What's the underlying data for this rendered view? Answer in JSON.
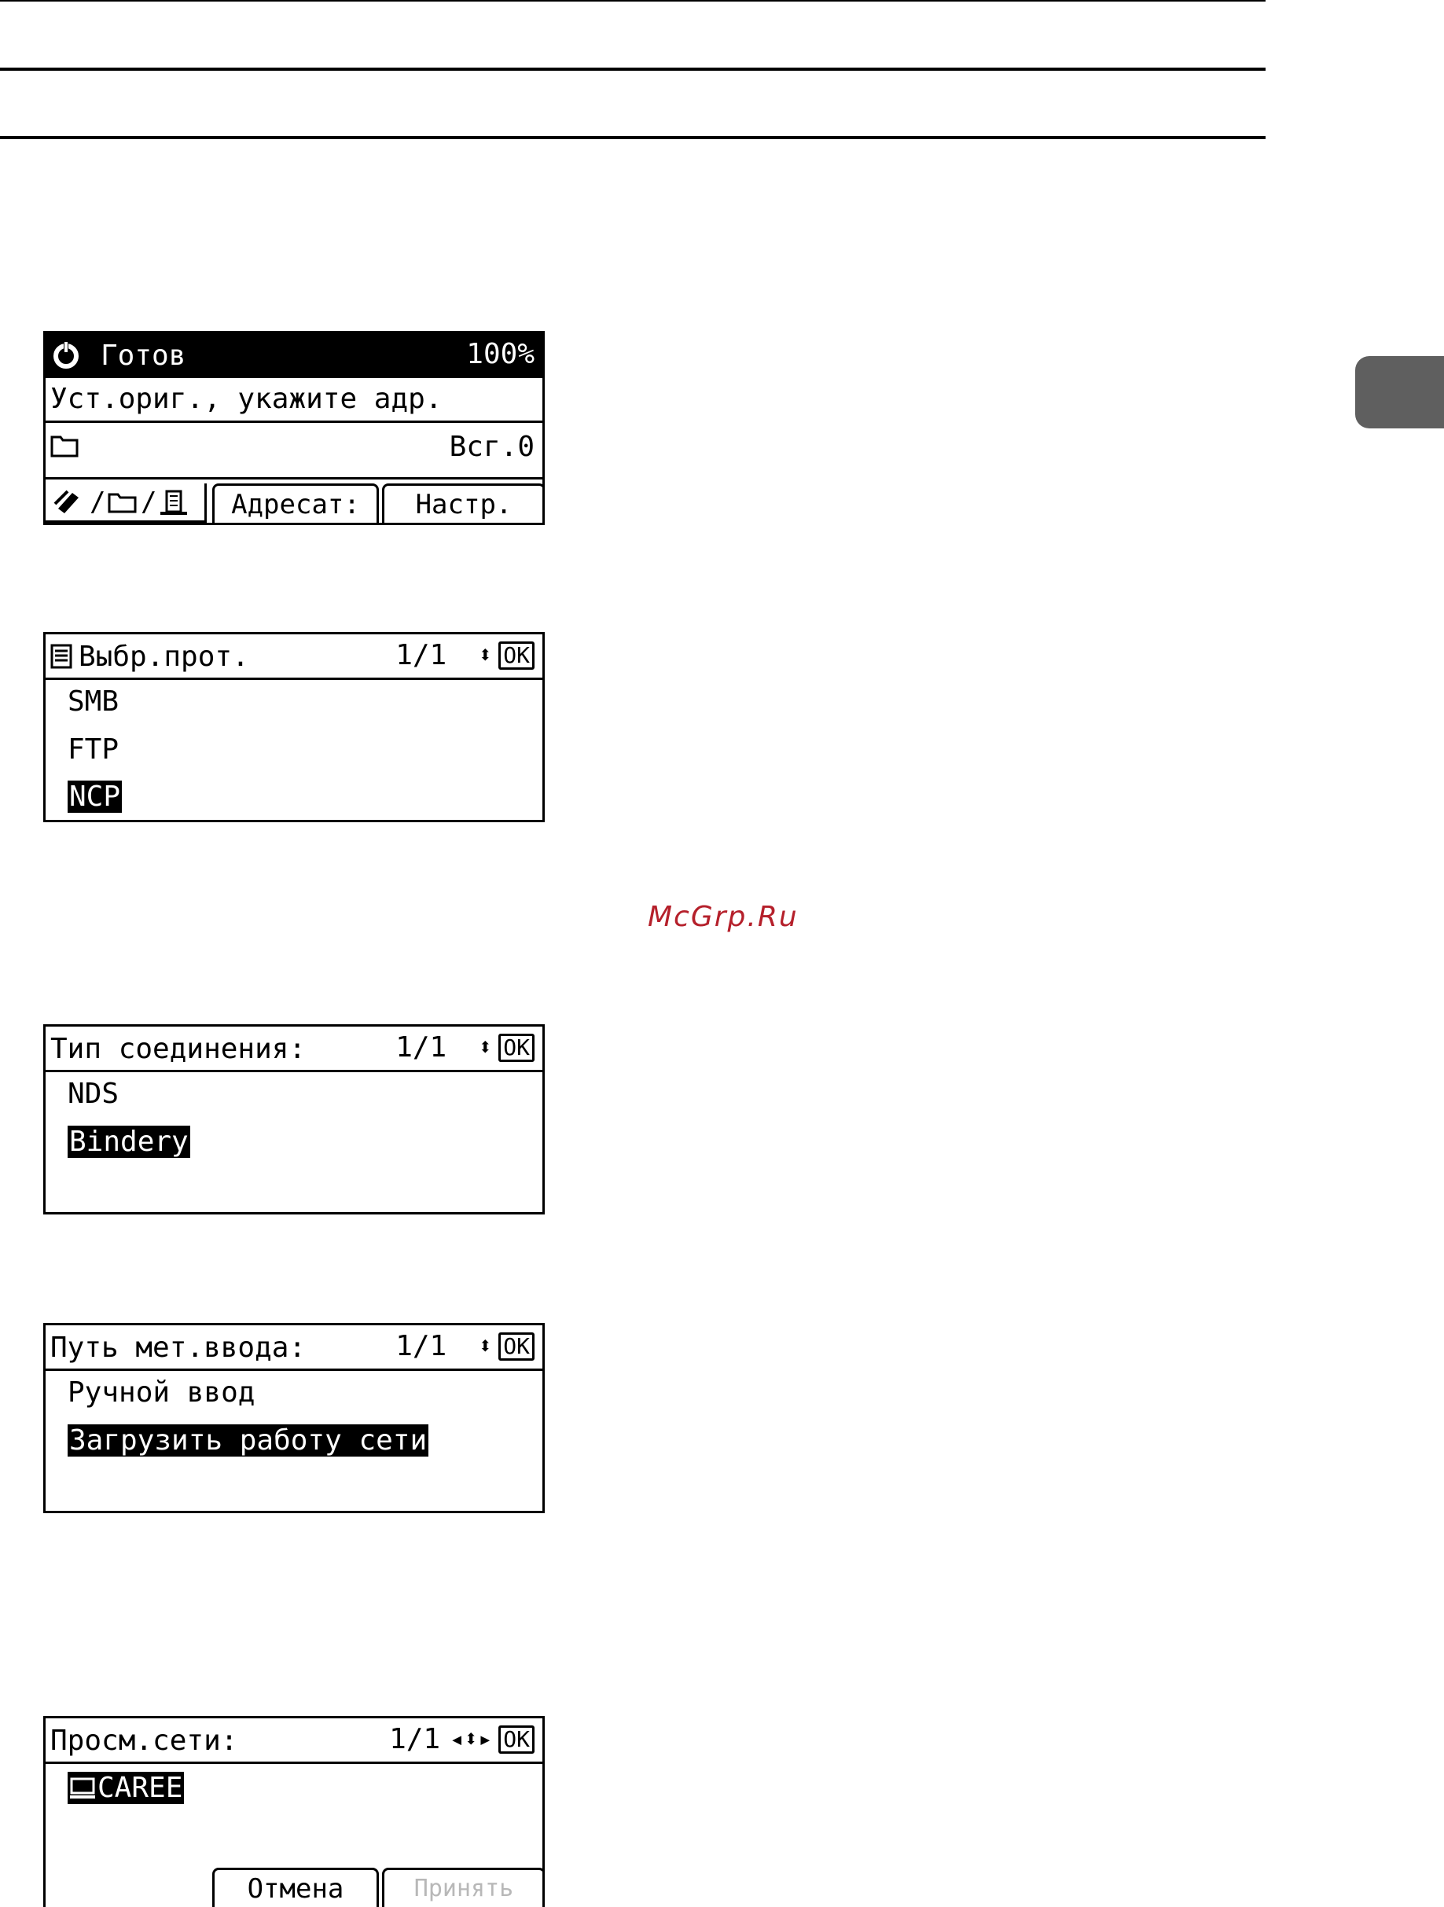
{
  "watermark": "McGrp.Ru",
  "screen1": {
    "status": "Готов",
    "zoom": "100%",
    "message": "Уст.ориг., укажите адр.",
    "total": "Всг.0",
    "tabs": [
      "/ /",
      "Адресат:",
      "Настр."
    ]
  },
  "screen2": {
    "title": "Выбр.прот.",
    "page": "1/1",
    "ok": "OK",
    "items": [
      "SMB",
      "FTP",
      "NCP"
    ],
    "selected": "NCP"
  },
  "screen3": {
    "title": "Тип соединения:",
    "page": "1/1",
    "ok": "OK",
    "items": [
      "NDS",
      "Bindery"
    ],
    "selected": "Bindery"
  },
  "screen4": {
    "title": "Путь мет.ввода:",
    "page": "1/1",
    "ok": "OK",
    "items": [
      "Ручной ввод",
      "Загрузить работу сети"
    ],
    "selected": "Загрузить работу сети"
  },
  "screen5": {
    "title": "Просм.сети:",
    "page": "1/1",
    "ok": "OK",
    "items": [
      "CAREE"
    ],
    "selected": "CAREE",
    "buttons": [
      "Отмена",
      "Принять"
    ]
  }
}
